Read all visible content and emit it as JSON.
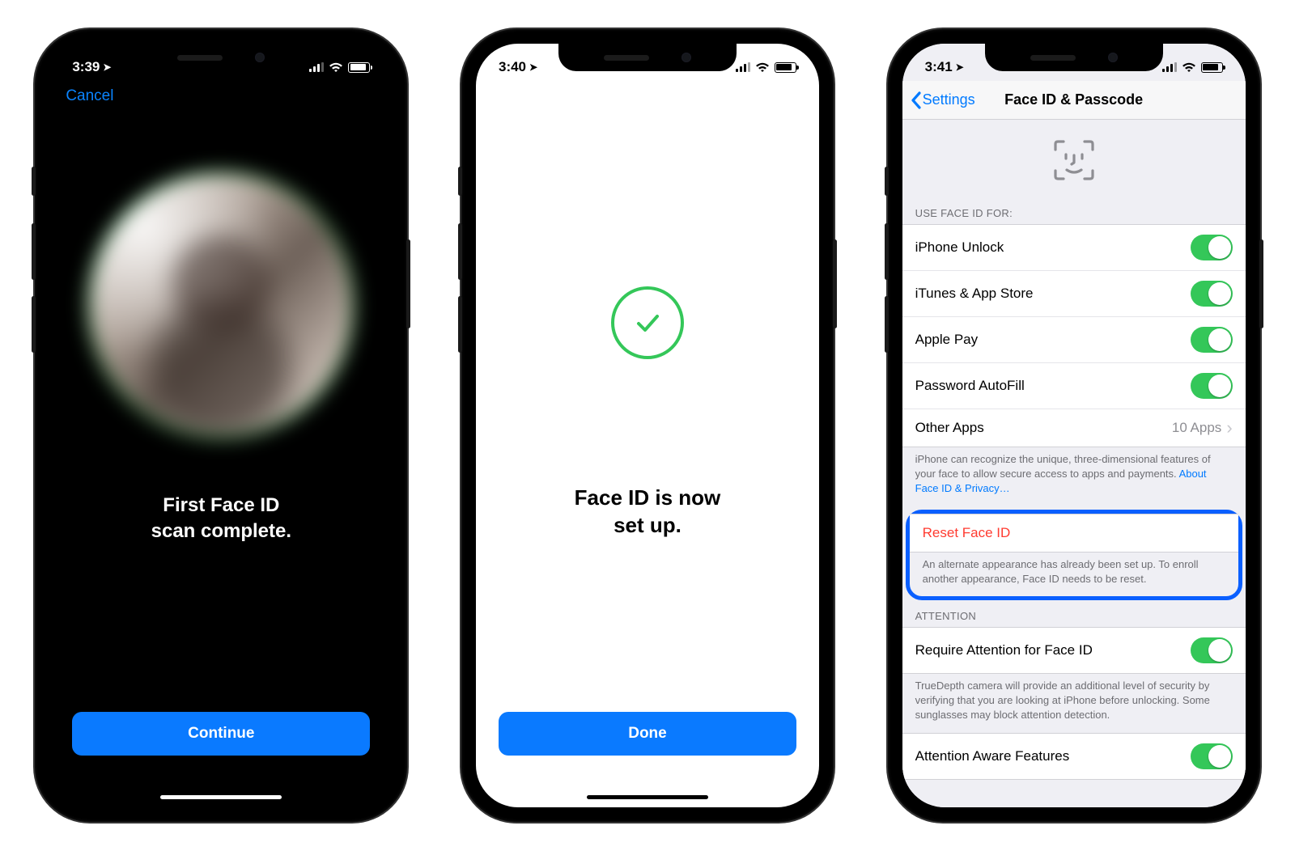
{
  "screen1": {
    "time": "3:39",
    "cancel": "Cancel",
    "message_l1": "First Face ID",
    "message_l2": "scan complete.",
    "button": "Continue"
  },
  "screen2": {
    "time": "3:40",
    "message_l1": "Face ID is now",
    "message_l2": "set up.",
    "button": "Done"
  },
  "screen3": {
    "time": "3:41",
    "back": "Settings",
    "title": "Face ID & Passcode",
    "group1_header": "USE FACE ID FOR:",
    "items": {
      "unlock": "iPhone Unlock",
      "store": "iTunes & App Store",
      "pay": "Apple Pay",
      "autofill": "Password AutoFill",
      "other": "Other Apps",
      "other_detail": "10 Apps"
    },
    "footer1": "iPhone can recognize the unique, three-dimensional features of your face to allow secure access to apps and payments.",
    "footer1_link": "About Face ID & Privacy…",
    "reset": "Reset Face ID",
    "reset_footer": "An alternate appearance has already been set up. To enroll another appearance, Face ID needs to be reset.",
    "attention_header": "ATTENTION",
    "require_attention": "Require Attention for Face ID",
    "attention_footer": "TrueDepth camera will provide an additional level of security by verifying that you are looking at iPhone before unlocking. Some sunglasses may block attention detection.",
    "aware": "Attention Aware Features"
  }
}
